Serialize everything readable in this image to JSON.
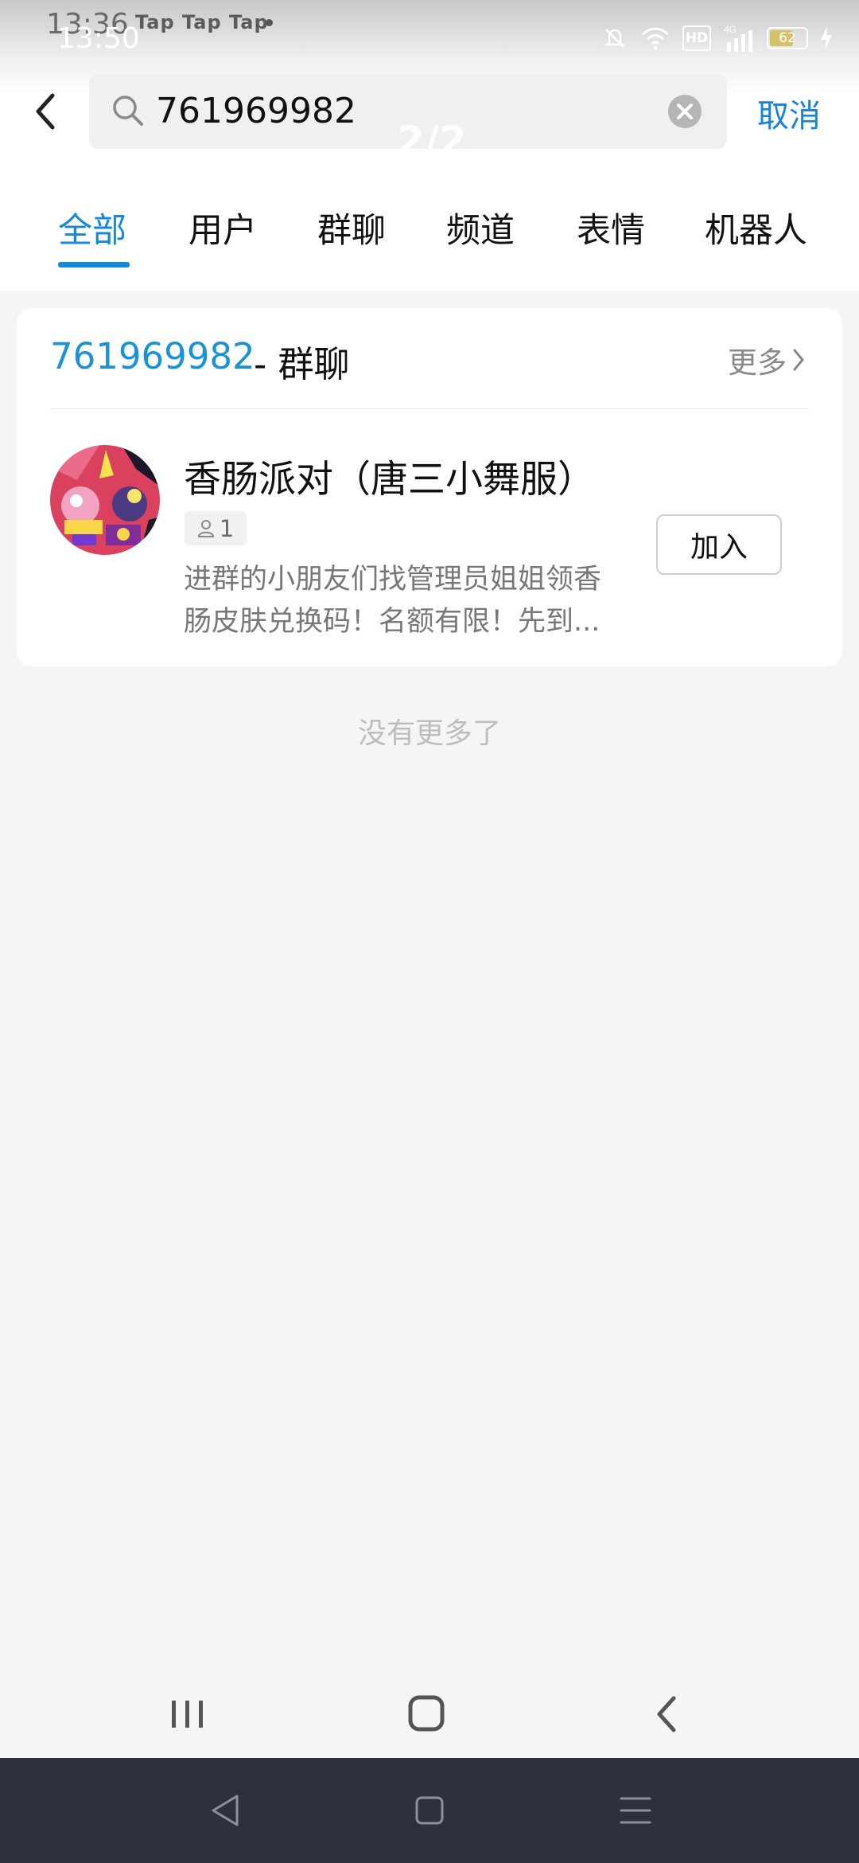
{
  "status_bar": {
    "time_background": "13:36",
    "tap_text": "Tap Tap Tap",
    "time_foreground": "13:50",
    "battery_level": "62",
    "hd_label": "HD",
    "network_label": "4G"
  },
  "overlay": {
    "page_indicator": "2/2"
  },
  "search": {
    "query": "761969982",
    "cancel_label": "取消"
  },
  "tabs": [
    {
      "label": "全部",
      "active": true
    },
    {
      "label": "用户",
      "active": false
    },
    {
      "label": "群聊",
      "active": false
    },
    {
      "label": "频道",
      "active": false
    },
    {
      "label": "表情",
      "active": false
    },
    {
      "label": "机器人",
      "active": false
    }
  ],
  "result_section": {
    "query": "761969982",
    "suffix": " - 群聊",
    "more_label": "更多"
  },
  "group_result": {
    "name": "香肠派对（唐三小舞服）",
    "member_count": "1",
    "description_line1": "进群的小朋友们找管理员姐姐领香",
    "description_line2": "肠皮肤兑换码！名额有限！先到...",
    "join_label": "加入"
  },
  "footer": {
    "no_more_label": "没有更多了"
  },
  "colors": {
    "accent": "#1389db",
    "result_query": "#1793d6",
    "secondary_text": "#777777",
    "nav_dark": "#2e3040"
  }
}
